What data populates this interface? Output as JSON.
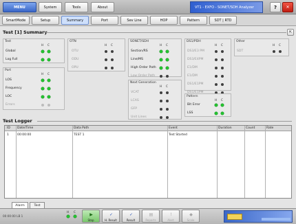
{
  "titlebar": {
    "top_buttons": [
      "MENU",
      "System",
      "Tools",
      "About"
    ],
    "app_title": "VT1 - EXFO - SONET/SDH Analyzer",
    "help_label": "?",
    "close_label": "✕"
  },
  "nav_tabs": [
    "SmartMode",
    "Setup",
    "Summary",
    "Port",
    "Sev Line",
    "HOP",
    "Pattern",
    "SDT | RTD"
  ],
  "active_tab": "Summary",
  "summary": {
    "title": "Test [1] Summary",
    "col_headers": [
      "H",
      "C"
    ],
    "groups": {
      "test": {
        "title": "Test",
        "rows": [
          {
            "label": "Global",
            "h": "g",
            "c": "g",
            "dim": false
          },
          {
            "label": "Log Full",
            "h": "g",
            "c": "g",
            "dim": false
          }
        ]
      },
      "port": {
        "title": "Port",
        "rows": [
          {
            "label": "LOS",
            "h": "g",
            "c": "g",
            "dim": false
          },
          {
            "label": "Frequency",
            "h": "g",
            "c": "g",
            "dim": false
          },
          {
            "label": "LOC",
            "h": "g",
            "c": "g",
            "dim": false
          },
          {
            "label": "Errors",
            "h": "off",
            "c": "off",
            "dim": true
          }
        ]
      },
      "otn": {
        "title": "OTN",
        "rows": [
          {
            "label": "OTU",
            "h": "k",
            "c": "k",
            "dim": true
          },
          {
            "label": "ODU",
            "h": "k",
            "c": "k",
            "dim": true
          },
          {
            "label": "OPU",
            "h": "k",
            "c": "k",
            "dim": true
          }
        ]
      },
      "sonet": {
        "title": "SONET/SDH",
        "rows": [
          {
            "label": "Section/RS",
            "h": "g",
            "c": "g",
            "dim": false
          },
          {
            "label": "Line/MS",
            "h": "g",
            "c": "g",
            "dim": false
          },
          {
            "label": "High Order Path",
            "h": "g",
            "c": "g",
            "dim": false
          },
          {
            "label": "Low Order Path",
            "h": "k",
            "c": "k",
            "dim": true
          }
        ]
      },
      "nextgen": {
        "title": "Next Generation",
        "rows": [
          {
            "label": "VCAT",
            "h": "k",
            "c": "k",
            "dim": true
          },
          {
            "label": "LCAS",
            "h": "k",
            "c": "k",
            "dim": true
          },
          {
            "label": "GFP",
            "h": "k",
            "c": "k",
            "dim": true
          },
          {
            "label": "Unit Lines",
            "h": "k",
            "c": "k",
            "dim": true
          }
        ]
      },
      "dsn": {
        "title": "DS1/PDH",
        "rows": [
          {
            "label": "DS3/E3 PM",
            "h": "k",
            "c": "k",
            "dim": true
          },
          {
            "label": "DS3/E4PM",
            "h": "k",
            "c": "k",
            "dim": true
          },
          {
            "label": "E1/DM",
            "h": "k",
            "c": "k",
            "dim": true
          },
          {
            "label": "E1/DM",
            "h": "k",
            "c": "k",
            "dim": true
          },
          {
            "label": "DS1/E1PM",
            "h": "k",
            "c": "k",
            "dim": true
          },
          {
            "label": "DS1/E1PM",
            "h": "k",
            "c": "k",
            "dim": true
          }
        ]
      },
      "pattern": {
        "title": "Pattern",
        "rows": [
          {
            "label": "Bit Error",
            "h": "g",
            "c": "g",
            "dim": false
          },
          {
            "label": "LSS",
            "h": "g",
            "c": "g",
            "dim": false
          }
        ]
      },
      "other": {
        "title": "Other",
        "rows": [
          {
            "label": "SDT",
            "h": "k",
            "c": "k",
            "dim": true
          }
        ]
      }
    }
  },
  "logger": {
    "title": "Test Logger",
    "columns": [
      "ID",
      "Date/Time",
      "Data Path",
      "Event",
      "Duration",
      "Count",
      "Rate"
    ],
    "rows": [
      [
        "1",
        "00:00:00",
        "TEST 1",
        "Test Started",
        "",
        "",
        ""
      ]
    ]
  },
  "bottom_tabs": [
    "Alarm",
    "Test"
  ],
  "status": {
    "left_text": "00:00:00 LB 1",
    "col_headers": [
      "H",
      "C"
    ],
    "buttons": [
      {
        "label": "Stop",
        "icon": "▶",
        "disabled": false,
        "active": true
      },
      {
        "label": "H. Result",
        "icon": "✓",
        "disabled": false,
        "active": false
      },
      {
        "label": "Result",
        "icon": "✓",
        "disabled": false,
        "active": false
      },
      {
        "label": "Reports",
        "icon": "▤",
        "disabled": true,
        "active": false
      },
      {
        "label": "Alert",
        "icon": "!",
        "disabled": true,
        "active": false
      },
      {
        "label": "Scale",
        "icon": "◆",
        "disabled": true,
        "active": false
      }
    ]
  },
  "colors": {
    "accent": "#3a67c8",
    "led_green": "#25c431",
    "led_dark": "#3f3f3f",
    "close_red": "#d22a1e"
  }
}
